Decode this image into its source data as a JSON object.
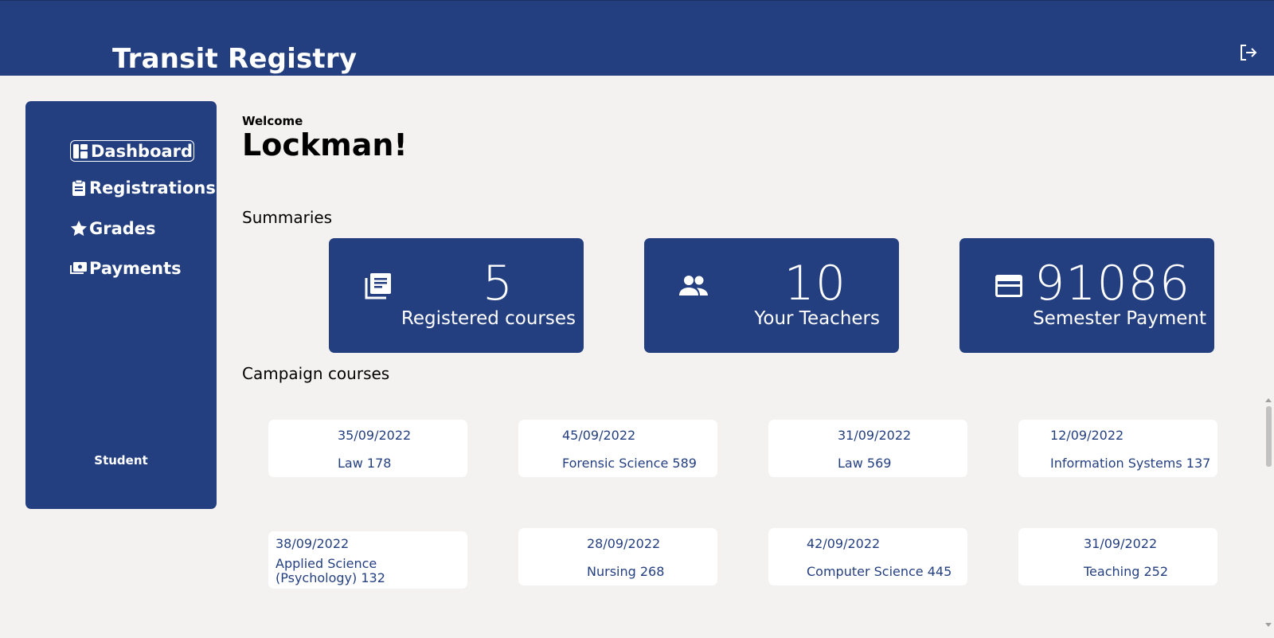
{
  "header": {
    "title": "Transit Registry",
    "logout_icon": "logout-icon"
  },
  "sidebar": {
    "items": [
      {
        "label": "Dashboard",
        "icon": "dashboard-icon",
        "active": true
      },
      {
        "label": "Registrations",
        "icon": "clipboard-icon",
        "active": false
      },
      {
        "label": "Grades",
        "icon": "star-icon",
        "active": false
      },
      {
        "label": "Payments",
        "icon": "payments-icon",
        "active": false
      }
    ],
    "role": "Student"
  },
  "main": {
    "welcome": "Welcome",
    "username": "Lockman!",
    "summaries_title": "Summaries",
    "summaries": [
      {
        "value": "5",
        "label": "Registered courses",
        "icon": "library-books-icon"
      },
      {
        "value": "10",
        "label": "Your Teachers",
        "icon": "people-icon"
      },
      {
        "value": "91086",
        "label": "Semester Payment",
        "icon": "credit-card-icon"
      }
    ],
    "campaign_title": "Campaign courses",
    "campaign_courses": [
      {
        "date": "35/09/2022",
        "name": "Law 178"
      },
      {
        "date": "45/09/2022",
        "name": "Forensic Science 589"
      },
      {
        "date": "31/09/2022",
        "name": "Law 569"
      },
      {
        "date": "12/09/2022",
        "name": "Information Systems 137"
      },
      {
        "date": "38/09/2022",
        "name": "Applied Science (Psychology) 132"
      },
      {
        "date": "28/09/2022",
        "name": "Nursing 268"
      },
      {
        "date": "42/09/2022",
        "name": "Computer Science 445"
      },
      {
        "date": "31/09/2022",
        "name": "Teaching 252"
      }
    ]
  },
  "colors": {
    "primary": "#243f80",
    "background": "#f3f2f1",
    "card": "#ffffff"
  }
}
